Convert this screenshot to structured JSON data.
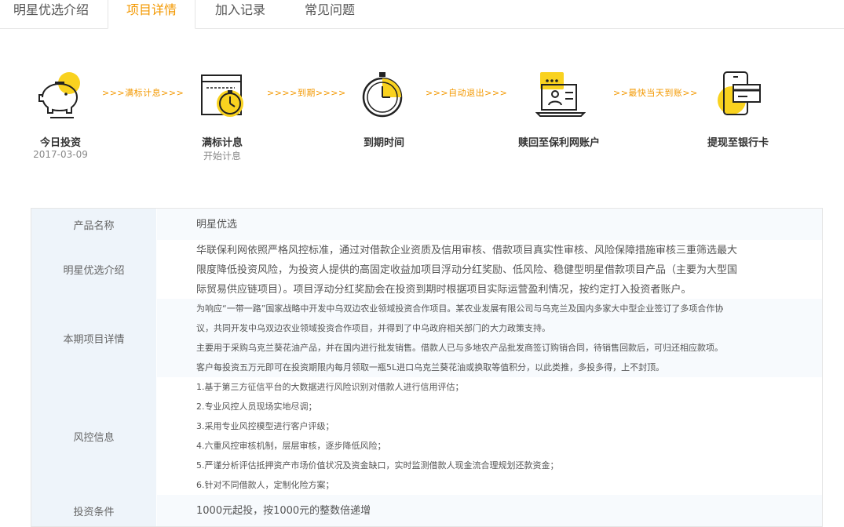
{
  "tabs": [
    {
      "label": "明星优选介绍",
      "active": false
    },
    {
      "label": "项目详情",
      "active": true
    },
    {
      "label": "加入记录",
      "active": false
    },
    {
      "label": "常见问题",
      "active": false
    }
  ],
  "steps": [
    {
      "title": "今日投资",
      "sub": "2017-03-09",
      "icon": "piggy-bank-icon"
    },
    {
      "title": "满标计息",
      "sub": "开始计息",
      "icon": "web-stopwatch-icon"
    },
    {
      "title": "到期时间",
      "sub": "",
      "icon": "stopwatch-icon"
    },
    {
      "title": "赎回至保利网账户",
      "sub": "",
      "icon": "user-account-icon"
    },
    {
      "title": "提现至银行卡",
      "sub": "",
      "icon": "phone-card-icon"
    }
  ],
  "arrows": [
    ">>>满标计息>>>",
    ">>>>到期>>>>",
    ">>>自动退出>>>",
    ">>最快当天到账>>"
  ],
  "colors": {
    "accent": "#f39800",
    "icon_yellow": "#f9d21f",
    "label_bg": "#eef4fa"
  },
  "details": {
    "product_name_label": "产品名称",
    "product_name": "明星优选",
    "intro_label": "明星优选介绍",
    "intro_lines": [
      "华联保利网依照严格风控标准，通过对借款企业资质及信用审核、借款项目真实性审核、风险保障措施审核三重筛选最大",
      "限度降低投资风险，为投资人提供的高固定收益加项目浮动分红奖励、低风险、稳健型明星借款项目产品（主要为大型国",
      "际贸易供应链项目）。项目浮动分红奖励会在投资到期时根据项目实际运营盈利情况，按约定打入投资者账户。"
    ],
    "current_label": "本期项目详情",
    "current_lines": [
      "为响应“一带一路”国家战略中开发中乌双边农业领域投资合作项目。某农业发展有限公司与乌克兰及国内多家大中型企业签订了多项合作协",
      "议，共同开发中乌双边农业领域投资合作项目，并得到了中乌政府相关部门的大力政策支持。",
      "主要用于采购乌克兰葵花油产品，并在国内进行批发销售。借款人已与多地农产品批发商签订购销合同，待销售回款后，可归还相应款项。",
      "客户每投资五万元即可在投资期限内每月领取一瓶5L进口乌克兰葵花油或换取等值积分，以此类推，多投多得，上不封顶。"
    ],
    "risk_label": "风控信息",
    "risk_lines": [
      "1.基于第三方征信平台的大数据进行风险识别对借款人进行信用评估；",
      "2.专业风控人员现场实地尽调；",
      "3.采用专业风控模型进行客户评级；",
      "4.六重风控审核机制，层层审核，逐步降低风险；",
      "5.严谨分析评估抵押资产市场价值状况及资金缺口，实时监测借款人现金流合理规划还款资金；",
      "6.针对不同借款人，定制化险方案；"
    ],
    "invest_label": "投资条件",
    "invest_value": "1000元起投，按1000元的整数倍递增"
  }
}
